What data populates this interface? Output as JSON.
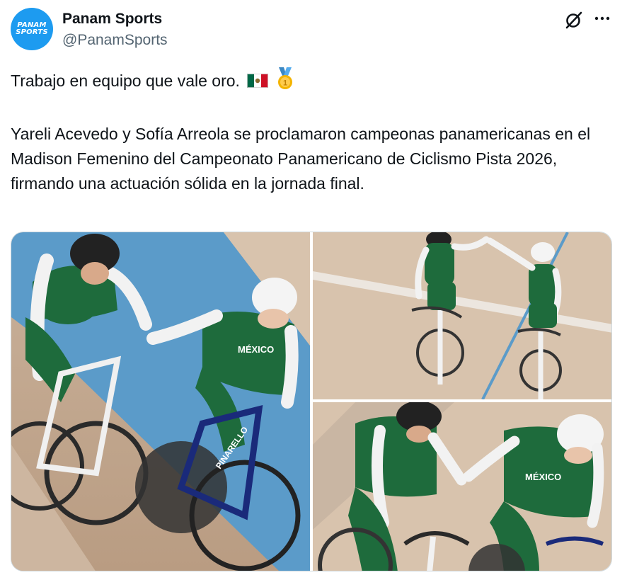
{
  "author": {
    "display_name": "Panam Sports",
    "handle": "@PanamSports",
    "avatar_logo_line1": "PANAM",
    "avatar_logo_line2": "SPORTS"
  },
  "actions": {
    "grok_icon": "grok-icon",
    "more_icon": "more-options-icon"
  },
  "tweet": {
    "line1": "Trabajo en equipo que vale oro.",
    "line1_emojis": [
      "mexico-flag-emoji",
      "gold-medal-emoji"
    ],
    "line2": "Yareli Acevedo y Sofía Arreola se proclamaron campeonas panamericanas en el Madison Femenino del Campeonato Panamericano de Ciclismo Pista 2026, firmando una actuación sólida en la jornada final."
  },
  "media": {
    "photo_count": 3,
    "jersey_text": "MÉXICO",
    "bike_brand_text": "PINARELLO"
  },
  "colors": {
    "accent_blue": "#1d9bf0",
    "handle_gray": "#536471",
    "jersey_green": "#1e6b3c",
    "track_wood": "#d8c3ad",
    "track_blue": "#5b9bc9"
  }
}
